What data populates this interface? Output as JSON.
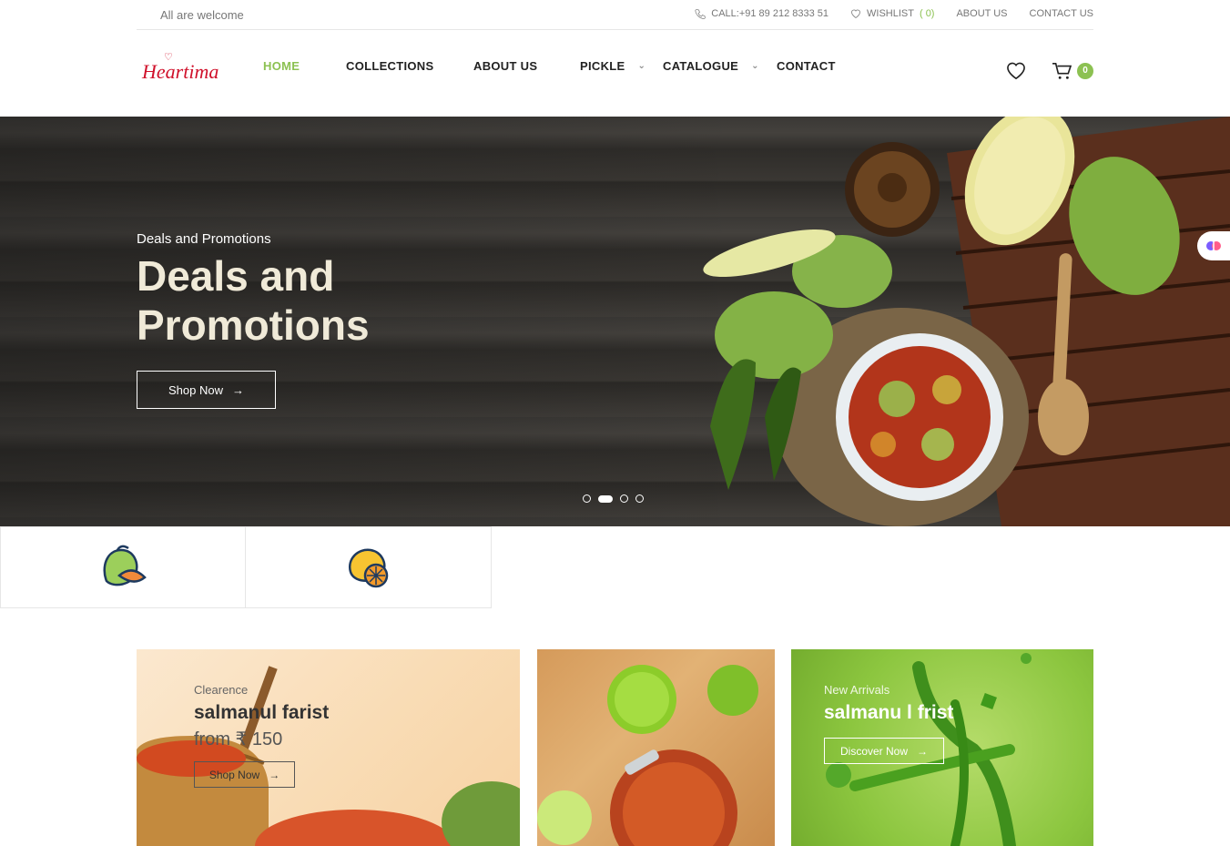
{
  "topbar": {
    "welcome": "All are welcome",
    "call": "CALL:+91 89 212 8333 51",
    "wishlist_label": "WISHLIST",
    "wishlist_count": "( 0)",
    "about": "ABOUT US",
    "contact": "CONTACT US"
  },
  "header": {
    "logo": "Heartima",
    "nav": [
      {
        "label": "HOME",
        "active": true
      },
      {
        "label": "COLLECTIONS"
      },
      {
        "label": "ABOUT US"
      },
      {
        "label": "PICKLE",
        "dropdown": true
      },
      {
        "label": "CATALOGUE",
        "dropdown": true
      },
      {
        "label": "CONTACT"
      }
    ],
    "cart_count": "0"
  },
  "hero": {
    "subtitle": "Deals and Promotions",
    "title": "Deals and Promotions",
    "button": "Shop Now",
    "slides": 4,
    "active_slide": 2
  },
  "categories": [
    {
      "icon": "mango-icon"
    },
    {
      "icon": "lemon-icon"
    }
  ],
  "banners": [
    {
      "subtitle": "Clearence",
      "title": "salmanul farist",
      "price": "from ₹ 150",
      "button": "Shop Now"
    },
    {},
    {
      "subtitle": "New Arrivals",
      "title": "salmanu l frist",
      "button": "Discover Now"
    }
  ],
  "colors": {
    "accent": "#8cc152",
    "logo": "#d0112b"
  }
}
